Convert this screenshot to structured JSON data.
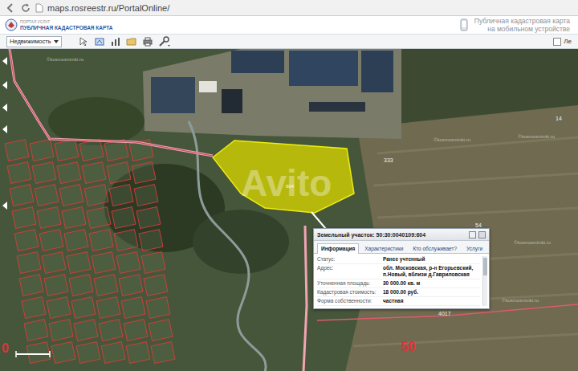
{
  "browser": {
    "url": "maps.rosreestr.ru/PortalOnline/"
  },
  "header": {
    "logo_top": "ПОРТАЛ УСЛУГ",
    "logo_title": "ПУБЛИЧНАЯ КАДАСТРОВАЯ КАРТА",
    "mobile_link": [
      "Публичная кадастровая карта",
      "на мобильном устройстве"
    ]
  },
  "toolbar": {
    "layer_select": "Недвижимость",
    "legend_label": "Ле",
    "legend_checked": false
  },
  "map": {
    "parcel": {
      "number": "604",
      "selected": true
    },
    "labels": [
      {
        "text": "333",
        "kind": "number"
      },
      {
        "text": "14",
        "kind": "number"
      },
      {
        "text": "54",
        "kind": "number"
      },
      {
        "text": "4017",
        "kind": "number"
      },
      {
        "text": "50",
        "kind": "zone"
      },
      {
        "text": "0",
        "kind": "zone"
      }
    ],
    "watermarks": [
      "©kosmosnimki.ru",
      "©kosmosnimki.ru",
      "©kosmosnimki.ru",
      "©kosmosnimki.ru",
      "©kosmosnimki.ru",
      "©kosmosnimki.ru"
    ],
    "overlay_watermark": "Avito"
  },
  "popup": {
    "title": "Земельный участок: 50:30:0040109:604",
    "tabs": [
      {
        "label": "Информация",
        "selected": true
      },
      {
        "label": "Характеристики",
        "selected": false
      },
      {
        "label": "Кто обслуживает?",
        "selected": false
      },
      {
        "label": "Услуги",
        "selected": false
      }
    ],
    "rows": [
      {
        "label": "Статус:",
        "value": "Ранее учтенный"
      },
      {
        "label": "Адрес:",
        "value": "обл. Московская, р-н Егорьевский, п.Новый, вблизи д.Гавриловская"
      },
      {
        "label": "Уточненная площадь:",
        "value": "30 000.00 кв. м"
      },
      {
        "label": "Кадастровая стоимость:",
        "value": "18 000.00 руб."
      },
      {
        "label": "Форма собственности:",
        "value": "частная"
      }
    ]
  }
}
